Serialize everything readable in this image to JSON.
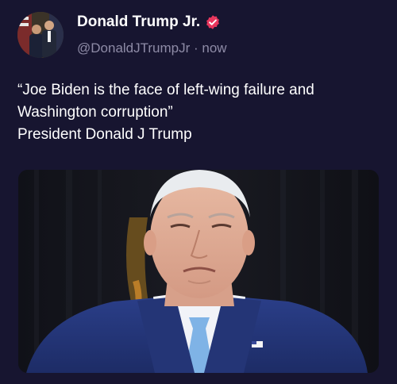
{
  "tweet": {
    "author": {
      "display_name": "Donald Trump Jr.",
      "handle": "@DonaldJTrumpJr",
      "verified": true,
      "verified_color": "#e8365d"
    },
    "separator": " · ",
    "time": "now",
    "text_lines": [
      "“Joe Biden is the face of left-wing failure and",
      "Washington corruption”",
      "President Donald J Trump"
    ]
  },
  "colors": {
    "background": "#171530",
    "text_primary": "#ffffff",
    "text_secondary": "#8e8ba6"
  }
}
